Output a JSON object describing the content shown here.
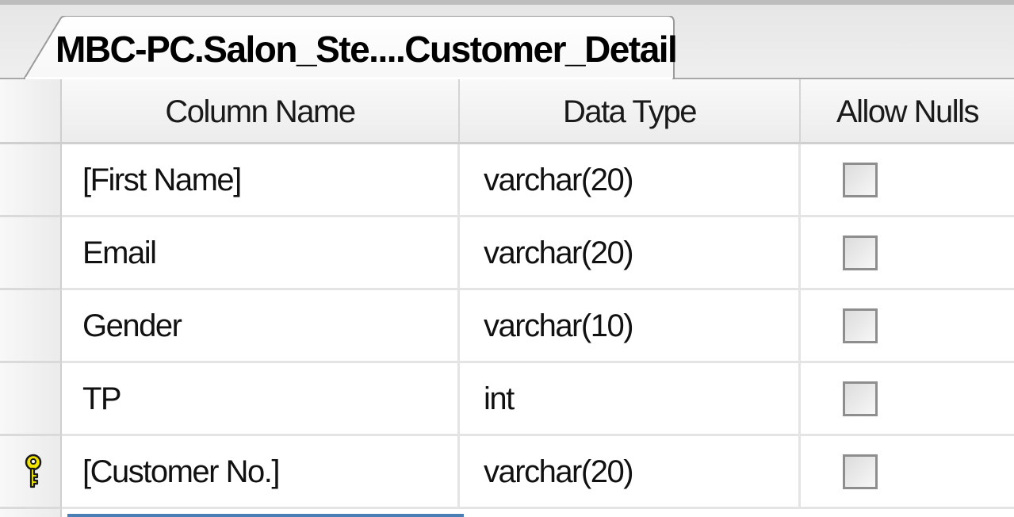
{
  "tab": {
    "title": "MBC-PC.Salon_Ste....Customer_Detail"
  },
  "grid": {
    "columns": {
      "column_name": "Column Name",
      "data_type": "Data Type",
      "allow_nulls": "Allow Nulls"
    },
    "rows": [
      {
        "name": "[First Name]",
        "type": "varchar(20)",
        "allow_nulls": false,
        "primary_key": false
      },
      {
        "name": "Email",
        "type": "varchar(20)",
        "allow_nulls": false,
        "primary_key": false
      },
      {
        "name": "Gender",
        "type": "varchar(10)",
        "allow_nulls": false,
        "primary_key": false
      },
      {
        "name": "TP",
        "type": "int",
        "allow_nulls": false,
        "primary_key": false
      },
      {
        "name": "[Customer No.]",
        "type": "varchar(20)",
        "allow_nulls": false,
        "primary_key": true
      }
    ]
  },
  "icons": {
    "primary_key": "key-icon",
    "key_color": "#f2e600"
  }
}
